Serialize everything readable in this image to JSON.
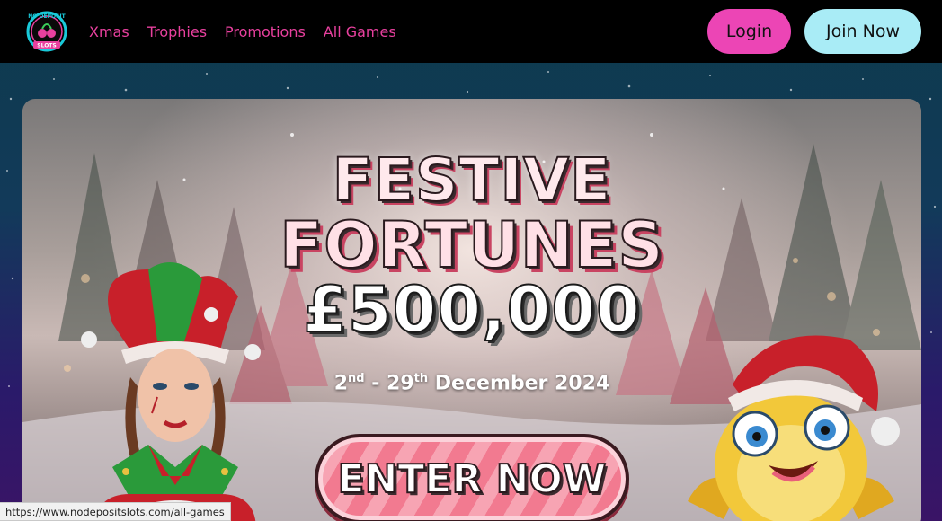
{
  "header": {
    "logo_text": "NO DEPOSIT SLOTS",
    "nav": [
      {
        "label": "Xmas"
      },
      {
        "label": "Trophies"
      },
      {
        "label": "Promotions"
      },
      {
        "label": "All Games"
      }
    ],
    "login_label": "Login",
    "join_label": "Join Now"
  },
  "banner": {
    "title_line1": "FESTIVE",
    "title_line2": "FORTUNES",
    "amount": "£500,000",
    "date_start_num": "2",
    "date_start_suffix": "nd",
    "date_sep": " - ",
    "date_end_num": "29",
    "date_end_suffix": "th",
    "date_rest": " December 2024",
    "cta_label": "ENTER NOW"
  },
  "status_bar": {
    "url": "https://www.nodepositslots.com/all-games"
  },
  "colors": {
    "nav_text": "#e8409e",
    "login_bg": "#ec45b5",
    "join_bg": "#a9ecf6",
    "header_bg": "#000000",
    "cta_pink": "#f27a90"
  }
}
